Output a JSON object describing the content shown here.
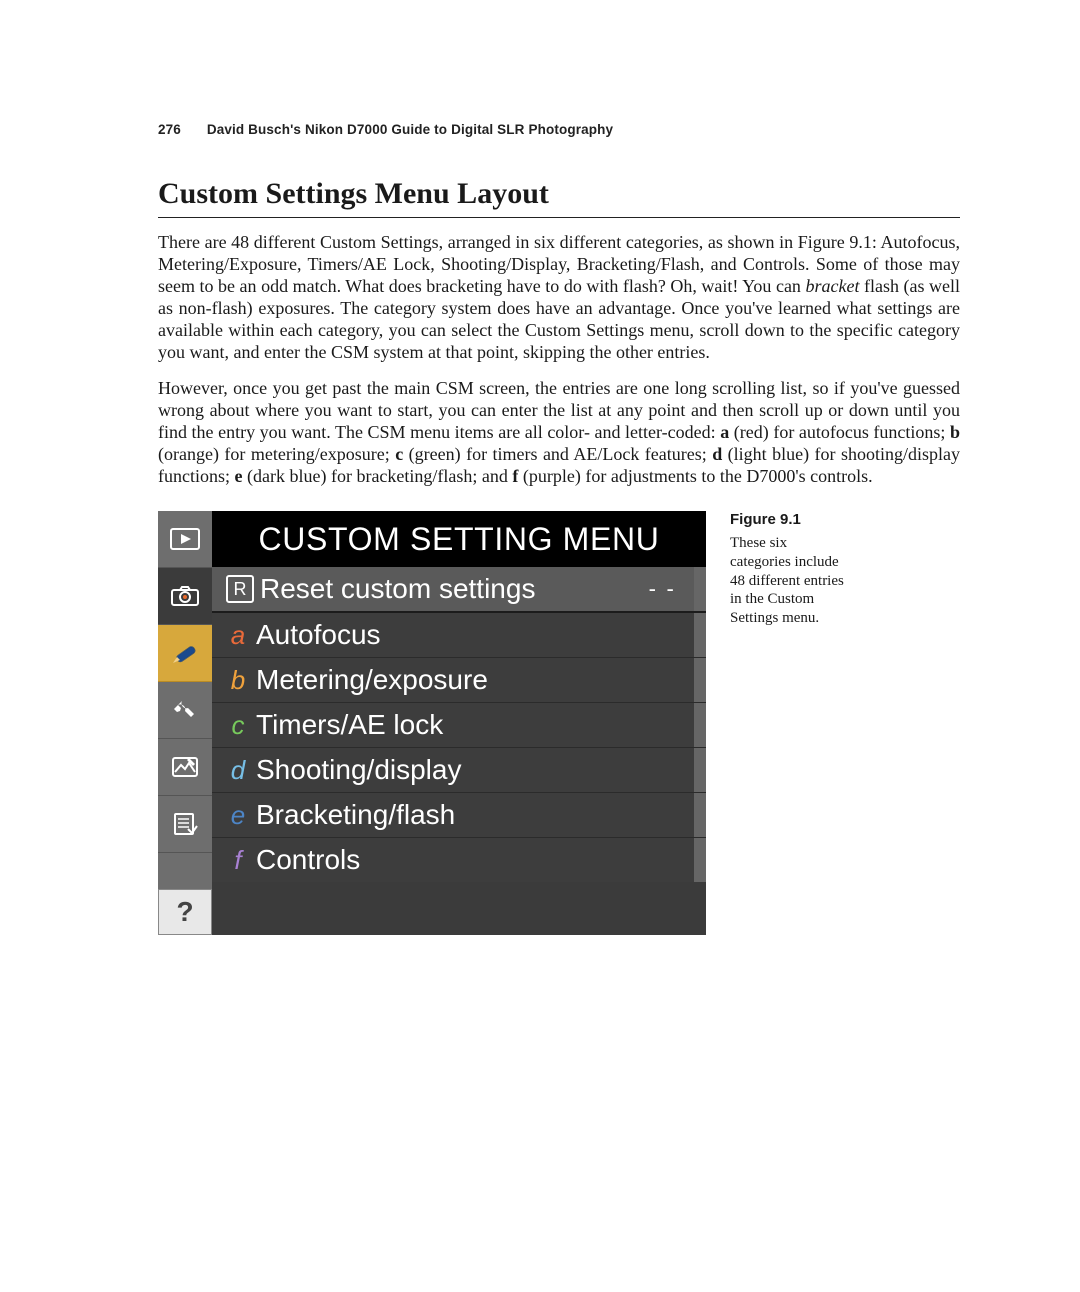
{
  "running_head": {
    "page_number": "276",
    "book_title": "David Busch's Nikon D7000 Guide to Digital SLR Photography"
  },
  "section_title": "Custom Settings Menu Layout",
  "paragraphs": {
    "p1_html": "There are 48 different Custom Settings, arranged in six different categories, as shown in Figure 9.1: Autofocus, Metering/Exposure, Timers/AE Lock, Shooting/Display, Bracketing/Flash, and Controls. Some of those may seem to be an odd match. What does bracketing have to do with flash? Oh, wait! You can <em>bracket</em> flash (as well as non-flash) exposures. The category system does have an advantage. Once you've learned what settings are available within each category, you can select the Custom Settings menu, scroll down to the specific category you want, and enter the CSM system at that point, skipping the other entries.",
    "p2_html": "However, once you get past the main CSM screen, the entries are one long scrolling list, so if you've guessed wrong about where you want to start, you can enter the list at any point and then scroll up or down until you find the entry you want. The CSM menu items are all color- and letter-coded: <b>a</b> (red) for autofocus functions; <b>b</b> (orange) for metering/exposure; <b>c</b> (green) for timers and AE/Lock features; <b>d</b> (light blue) for shooting/display functions; <b>e</b> (dark blue) for bracketing/flash; and <b>f</b> (purple) for adjustments to the D7000's controls."
  },
  "camera_menu": {
    "title": "CUSTOM SETTING MENU",
    "sidebar": [
      {
        "icon": "play",
        "selected": false
      },
      {
        "icon": "camera",
        "selected": false
      },
      {
        "icon": "pencil",
        "selected": true
      },
      {
        "icon": "wrench",
        "selected": false
      },
      {
        "icon": "retouch",
        "selected": false
      },
      {
        "icon": "myMenu",
        "selected": false
      }
    ],
    "help_label": "?",
    "rows": [
      {
        "type": "reset",
        "key": "R",
        "label": "Reset custom settings",
        "value": "- -",
        "highlight": true
      },
      {
        "type": "cat",
        "key": "a",
        "label": "Autofocus",
        "color": "k-a"
      },
      {
        "type": "cat",
        "key": "b",
        "label": "Metering/exposure",
        "color": "k-b"
      },
      {
        "type": "cat",
        "key": "c",
        "label": "Timers/AE lock",
        "color": "k-c"
      },
      {
        "type": "cat",
        "key": "d",
        "label": "Shooting/display",
        "color": "k-d"
      },
      {
        "type": "cat",
        "key": "e",
        "label": "Bracketing/flash",
        "color": "k-e"
      },
      {
        "type": "cat",
        "key": "f",
        "label": "Controls",
        "color": "k-f"
      }
    ]
  },
  "figure": {
    "label": "Figure 9.1",
    "caption": "These six categories include 48 different entries in the Custom Settings menu."
  }
}
